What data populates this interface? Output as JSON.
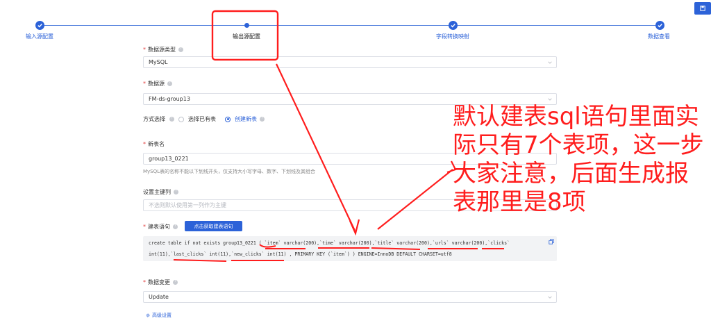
{
  "steps": [
    {
      "label": "输入源配置",
      "status": "done"
    },
    {
      "label": "输出源配置",
      "status": "current"
    },
    {
      "label": "字段转换映射",
      "status": "done"
    },
    {
      "label": "数据查看",
      "status": "done"
    }
  ],
  "top_button_icon": "save-icon",
  "form": {
    "source_type": {
      "label": "数据源类型",
      "value": "MySQL"
    },
    "datasource": {
      "label": "数据源",
      "value": "FM-ds-group13"
    },
    "mode": {
      "label": "方式选择",
      "options": [
        "选择已有表",
        "创建新表"
      ],
      "selected": "创建新表"
    },
    "new_table": {
      "label": "新表名",
      "value": "group13_0221",
      "hint": "MySQL表的名称不能以下划线开头，仅支持大小写字母、数字、下划线及其组合"
    },
    "primary_key": {
      "label": "设置主键列",
      "placeholder": "不选则默认使用第一列作为主键"
    },
    "ddl": {
      "label": "建表语句",
      "button": "点击获取建表语句",
      "line1": "create table if not exists group13_0221 ( `item` varchar(200),`time` varchar(200),`title` varchar(200),`urls` varchar(200),`clicks`",
      "line2": "int(11),`last_clicks` int(11),`new_clicks` int(11) , PRIMARY KEY (`item`) ) ENGINE=InnoDB DEFAULT CHARSET=utf8"
    },
    "data_change": {
      "label": "数据变更",
      "value": "Update"
    },
    "advanced": "高级设置"
  },
  "annotation": {
    "color": "#ff1d1d",
    "lines": [
      "默认建表sql语句里面实",
      "际只有7个表项，这一步",
      "大家注意，后面生成报",
      "表那里是8项"
    ]
  },
  "colors": {
    "primary": "#2c62d8",
    "required": "#e23b3b"
  }
}
